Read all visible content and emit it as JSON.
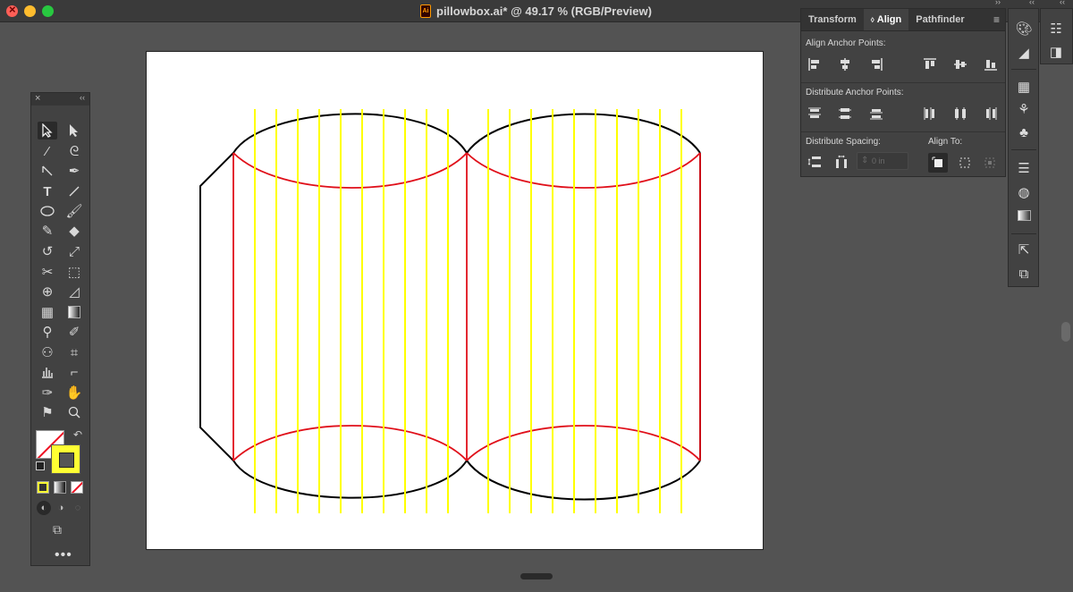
{
  "window": {
    "title": "pillowbox.ai* @ 49.17 % (RGB/Preview)",
    "file_icon_label": "Ai"
  },
  "align_panel": {
    "tabs": [
      "Transform",
      "Align",
      "Pathfinder"
    ],
    "active_tab": "Align",
    "align_anchor_label": "Align Anchor Points:",
    "distribute_anchor_label": "Distribute Anchor Points:",
    "distribute_spacing_label": "Distribute Spacing:",
    "align_to_label": "Align To:",
    "spacing_value": "0 in"
  },
  "tools_panel": {
    "active_tool": "selection",
    "fill": "none",
    "stroke_color": "#ffff33"
  },
  "colors": {
    "canvas_bg": "#535353",
    "panel_bg": "#424242",
    "guide_yellow": "#ffff00",
    "cut_red": "#e0101a",
    "outline_black": "#000000"
  }
}
